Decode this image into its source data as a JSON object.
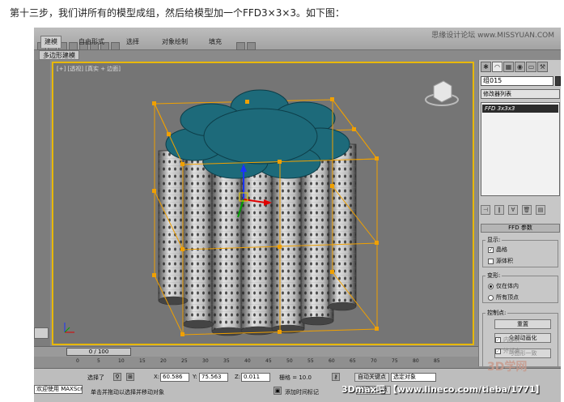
{
  "caption": "第十三步，我们讲所有的模型成组，然后给模型加一个FFD3×3×3。如下图：",
  "ribbon": {
    "tabs": [
      "建模",
      "自由形式",
      "选择",
      "对象绘制",
      "填充"
    ],
    "subtab": "多边形建模",
    "watermark": "思缘设计论坛  www.MISSYUAN.COM"
  },
  "viewport": {
    "label": "[+] [透视] [真实 + 边面]",
    "border_color": "#e8b800",
    "cap_color": "#1d6a7a",
    "lattice_color": "#f0a000"
  },
  "command_panel": {
    "tabs": [
      "create-icon",
      "modify-icon",
      "hierarchy-icon",
      "motion-icon",
      "display-icon",
      "utilities-icon"
    ],
    "object_name": "组015",
    "modifier_list": "修改器列表",
    "stack_item": "FFD 3x3x3",
    "rollout_title": "FFD 参数",
    "display_group": "显示:",
    "lattice_label": "晶格",
    "source_volume_label": "源体积",
    "deform_group": "变形:",
    "only_in_volume": "仅在体内",
    "all_vertices": "所有顶点",
    "control_points_group": "控制点:",
    "reset_btn": "重置",
    "animate_all_btn": "全部动画化",
    "conform_btn": "与图形一致",
    "inside_points": "内部点",
    "outside_points": "外部点"
  },
  "timeline": {
    "slider": "0 / 100",
    "ticks": [
      "0",
      "5",
      "10",
      "15",
      "20",
      "25",
      "30",
      "35",
      "40",
      "45",
      "50",
      "55",
      "60",
      "65",
      "70",
      "75",
      "80",
      "85"
    ]
  },
  "statusbar": {
    "welcome": "欢迎使用 MAXScr",
    "selected": "选择了",
    "x_label": "X:",
    "x_value": "60.586",
    "y_label": "Y:",
    "y_value": "75.563",
    "z_label": "Z:",
    "z_value": "0.011",
    "grid": "栅格 = 10.0",
    "auto_key": "自动关键点",
    "set_key": "设置关键点",
    "selection_set": "选定对象",
    "prompt": "单击并拖动以选择并移动对象",
    "add_time_tag": "添加时间标记",
    "footer_watermark": "3Dmax吧 【www.lineco.com/tieba/1771】",
    "site_logo": "3D学网"
  }
}
